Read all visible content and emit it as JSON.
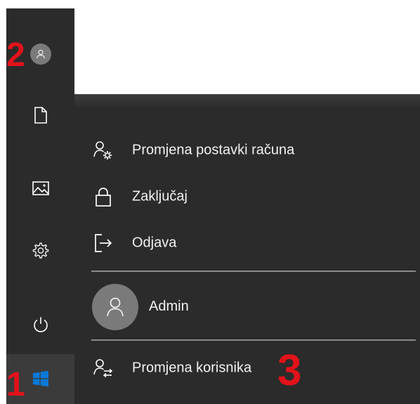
{
  "rail": {
    "items": [
      {
        "name": "user-account",
        "icon": "person-icon"
      },
      {
        "name": "documents",
        "icon": "document-icon"
      },
      {
        "name": "pictures",
        "icon": "picture-icon"
      },
      {
        "name": "settings",
        "icon": "gear-icon"
      },
      {
        "name": "power",
        "icon": "power-icon"
      },
      {
        "name": "start",
        "icon": "windows-logo-icon"
      }
    ]
  },
  "flyout": {
    "items": [
      {
        "label": "Promjena postavki računa",
        "icon": "person-settings-icon"
      },
      {
        "label": "Zaključaj",
        "icon": "lock-icon"
      },
      {
        "label": "Odjava",
        "icon": "sign-out-icon"
      }
    ],
    "current_user": "Admin",
    "switch_user": {
      "label": "Promjena korisnika",
      "icon": "switch-user-icon"
    }
  },
  "callouts": {
    "one": "1",
    "two": "2",
    "three": "3"
  },
  "colors": {
    "rail_bg": "#2b2b2b",
    "flyout_bg": "#2b2b2b",
    "callout": "#e3121b",
    "windows_blue": "#0a78d7"
  }
}
